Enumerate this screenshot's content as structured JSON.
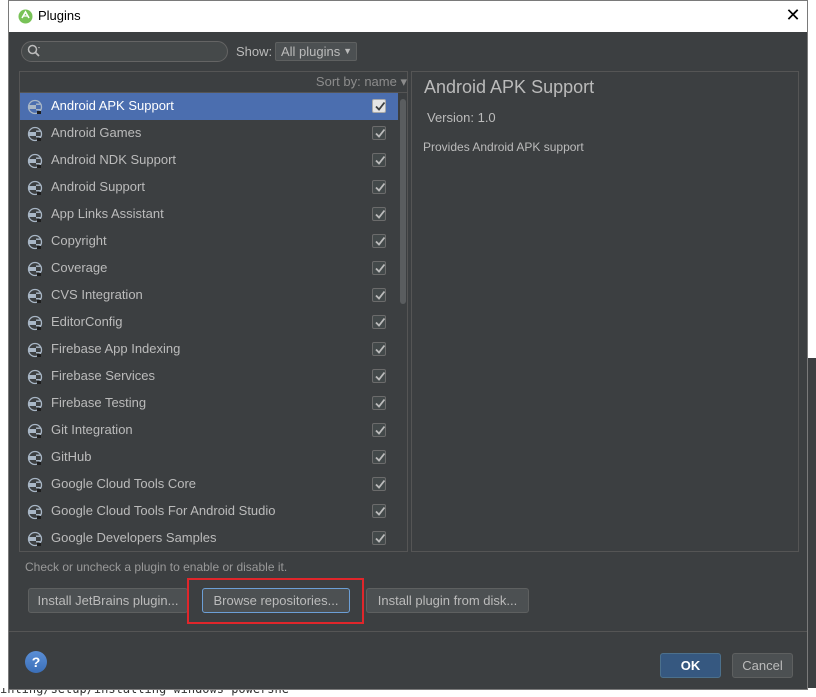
{
  "window": {
    "title": "Plugins",
    "close_glyph": "✕"
  },
  "search": {
    "placeholder": "",
    "show_label": "Show:",
    "show_value": "All plugins"
  },
  "list": {
    "sort_label": "Sort by: name ▾",
    "selected_index": 0,
    "plugins": [
      {
        "name": "Android APK Support",
        "checked": true
      },
      {
        "name": "Android Games",
        "checked": true
      },
      {
        "name": "Android NDK Support",
        "checked": true
      },
      {
        "name": "Android Support",
        "checked": true
      },
      {
        "name": "App Links Assistant",
        "checked": true
      },
      {
        "name": "Copyright",
        "checked": true
      },
      {
        "name": "Coverage",
        "checked": true
      },
      {
        "name": "CVS Integration",
        "checked": true
      },
      {
        "name": "EditorConfig",
        "checked": true
      },
      {
        "name": "Firebase App Indexing",
        "checked": true
      },
      {
        "name": "Firebase Services",
        "checked": true
      },
      {
        "name": "Firebase Testing",
        "checked": true
      },
      {
        "name": "Git Integration",
        "checked": true
      },
      {
        "name": "GitHub",
        "checked": true
      },
      {
        "name": "Google Cloud Tools Core",
        "checked": true
      },
      {
        "name": "Google Cloud Tools For Android Studio",
        "checked": true
      },
      {
        "name": "Google Developers Samples",
        "checked": true
      }
    ]
  },
  "detail": {
    "title": "Android APK Support",
    "version": "Version: 1.0",
    "description": "Provides Android APK support"
  },
  "hint": "Check or uncheck a plugin to enable or disable it.",
  "buttons": {
    "install_jetbrains": "Install JetBrains plugin...",
    "browse_repositories": "Browse repositories...",
    "install_from_disk": "Install plugin from disk...",
    "help": "?",
    "ok": "OK",
    "cancel": "Cancel"
  },
  "background": {
    "bottom_text": "inting/setup/installing-windows-powershe"
  },
  "colors": {
    "dialog_bg": "#3c3f41",
    "selection": "#4b6eaf",
    "highlight_frame": "#e0262b",
    "ok_button": "#365880"
  }
}
